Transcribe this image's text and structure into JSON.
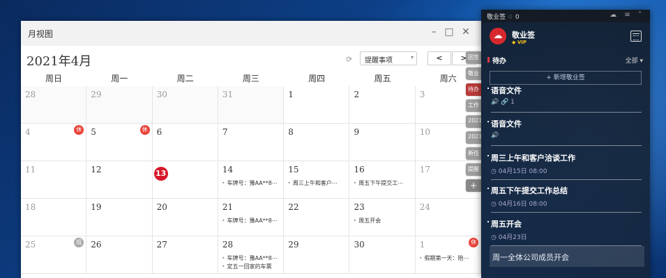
{
  "calendar": {
    "window_title": "月视图",
    "month_title": "2021年4月",
    "window_controls": [
      "–",
      "□",
      "✕"
    ],
    "remind_filter": "提醒事项",
    "nav_prev": "<",
    "nav_next": ">",
    "weekdays": [
      "周日",
      "周一",
      "周二",
      "周三",
      "周四",
      "周五",
      "周六"
    ],
    "weekday_last_visible": "周六",
    "weeks": [
      [
        {
          "day": "28",
          "prev": true
        },
        {
          "day": "29",
          "prev": true
        },
        {
          "day": "30",
          "prev": true
        },
        {
          "day": "31",
          "prev": true
        },
        {
          "day": "1"
        },
        {
          "day": "2"
        },
        {
          "day": "3",
          "wk": true
        }
      ],
      [
        {
          "day": "4",
          "wk": true,
          "badge": "休"
        },
        {
          "day": "5",
          "badge": "休"
        },
        {
          "day": "6"
        },
        {
          "day": "7"
        },
        {
          "day": "8"
        },
        {
          "day": "9"
        },
        {
          "day": "10",
          "wk": true
        }
      ],
      [
        {
          "day": "11",
          "wk": true
        },
        {
          "day": "12"
        },
        {
          "day": "13",
          "today": true
        },
        {
          "day": "14",
          "events": [
            "车牌号：豫AA**8⋯"
          ]
        },
        {
          "day": "15",
          "events": [
            "周三上午和客户⋯"
          ]
        },
        {
          "day": "16",
          "events": [
            "周五下午提交工⋯"
          ]
        },
        {
          "day": "17",
          "wk": true
        }
      ],
      [
        {
          "day": "18",
          "wk": true
        },
        {
          "day": "19"
        },
        {
          "day": "20"
        },
        {
          "day": "21",
          "events": [
            "车牌号：豫AA**8⋯"
          ]
        },
        {
          "day": "22"
        },
        {
          "day": "23",
          "events": [
            "周五开会"
          ]
        },
        {
          "day": "24",
          "wk": true
        }
      ],
      [
        {
          "day": "25",
          "wk": true,
          "badge": "班",
          "badge_gray": true
        },
        {
          "day": "26"
        },
        {
          "day": "27"
        },
        {
          "day": "28",
          "events": [
            "车牌号：豫AA**8⋯",
            "定五一回家的车票"
          ]
        },
        {
          "day": "29"
        },
        {
          "day": "30"
        },
        {
          "day": "1",
          "wk": true,
          "badge": "休",
          "events": [
            "假期第一天：陪⋯"
          ]
        }
      ]
    ],
    "side_tabs": [
      {
        "label": "团签"
      },
      {
        "label": "敬业"
      },
      {
        "label": "待办",
        "active": true
      },
      {
        "label": "工作"
      },
      {
        "label": "2021"
      },
      {
        "label": "2021"
      },
      {
        "label": "新任"
      },
      {
        "label": "提醒"
      },
      {
        "label": "+",
        "plus": true
      }
    ]
  },
  "notes": {
    "top_title": "敬业签",
    "top_count": "0",
    "top_icons": "☁ ≡ ˄",
    "app_name": "敬业签",
    "vip": "VIP",
    "category": "待办",
    "filter": "全部 ▾",
    "add_label": "+ 新增敬业签",
    "items": [
      {
        "title": "语音文件",
        "sub": "🔊 🔗 1"
      },
      {
        "title": "语音文件",
        "sub": "🔊"
      },
      {
        "title": "周三上午和客户洽谈工作",
        "sub": "◷ 04月15日 08:00"
      },
      {
        "title": "周五下午提交工作总结",
        "sub": "◷ 04月16日 08:00"
      },
      {
        "title": "周五开会",
        "sub": "◷ 04月23日"
      }
    ],
    "last_item": "周一全体公司成员开会"
  }
}
